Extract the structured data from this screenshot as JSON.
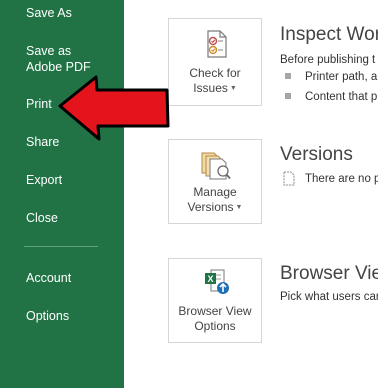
{
  "sidebar": {
    "items": [
      {
        "label": "Save As"
      },
      {
        "label": "Save as Adobe PDF"
      },
      {
        "label": "Print"
      },
      {
        "label": "Share"
      },
      {
        "label": "Export"
      },
      {
        "label": "Close"
      },
      {
        "label": "Account"
      },
      {
        "label": "Options"
      }
    ]
  },
  "inspect": {
    "button_line1": "Check for",
    "button_line2": "Issues",
    "title": "Inspect Wor",
    "description": "Before publishing t",
    "bullets": [
      "Printer path, a",
      "Content that p"
    ]
  },
  "versions": {
    "button_line1": "Manage",
    "button_line2": "Versions",
    "title": "Versions",
    "note": "There are no p"
  },
  "browser_view": {
    "button_line1": "Browser View",
    "button_line2": "Options",
    "title": "Browser Vie",
    "description": "Pick what users car"
  },
  "icons": {
    "check_issues": "check-document-icon",
    "versions": "document-versions-icon",
    "browser_view": "excel-browser-icon",
    "dropdown": "caret-down-icon",
    "annotation": "red-arrow-annotation"
  },
  "colors": {
    "sidebar": "#217346",
    "arrow": "#e3141b",
    "tile_border": "#d6d6d6"
  }
}
